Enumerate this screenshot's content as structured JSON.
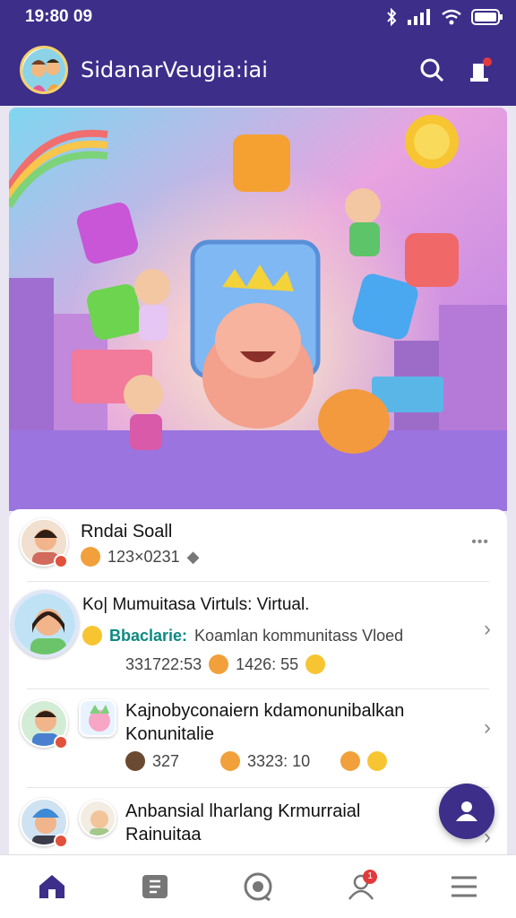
{
  "status_bar": {
    "time": "19:80 09"
  },
  "app_bar": {
    "title": "SidanarVeugia:iai"
  },
  "feed": [
    {
      "name": "Rndai Soall",
      "sub_text": "123×0231",
      "more_label": "•••"
    },
    {
      "name": "Ko| Mumuitasa Virtuls: Virtual.",
      "highlight": "Bbaclarie:",
      "sub_text": "Koamlan kommunitass Vloed",
      "stat_a": "331722:53",
      "stat_b": "1426: 55"
    },
    {
      "name_line1": "Kajnobyconaiern kdamonunibalkan",
      "name_line2": "Konunitalie",
      "stat_a": "327",
      "stat_b": "3323: 10"
    },
    {
      "name_line1": "Anbansial lharlang Krmurraial",
      "name_line2": "Rainuitaa"
    }
  ],
  "colors": {
    "brand": "#3d2e8a",
    "accent_teal": "#0c8a80",
    "badge_red": "#e2513b"
  },
  "icons": [
    "bluetooth-icon",
    "signal-icon",
    "wifi-icon",
    "battery-icon",
    "search-icon",
    "notification-icon",
    "home-icon",
    "news-icon",
    "chat-icon",
    "profile-icon",
    "menu-icon",
    "add-user-icon",
    "chevron-right-icon"
  ]
}
